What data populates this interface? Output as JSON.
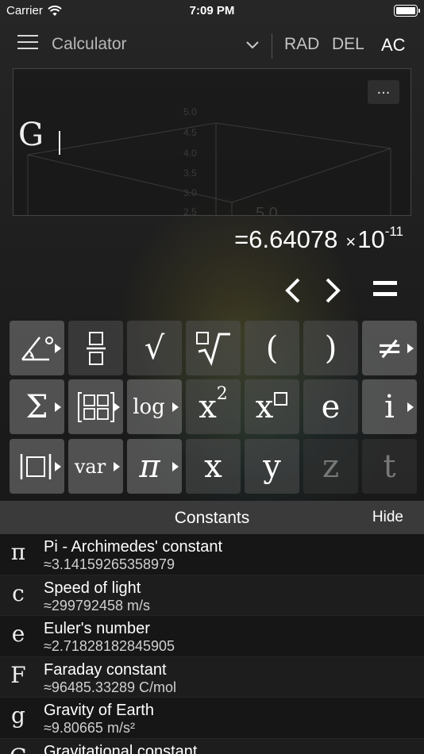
{
  "status_bar": {
    "carrier": "Carrier",
    "time": "7:09 PM"
  },
  "toolbar": {
    "title": "Calculator",
    "rad": "RAD",
    "del": "DEL",
    "ac": "AC"
  },
  "display": {
    "more": "...",
    "expression": "G",
    "plot_ticks": [
      "5.0",
      "4.5",
      "4.0",
      "3.5",
      "3.0",
      "2.5",
      "5.0"
    ]
  },
  "result": {
    "mantissa": "=6.64078",
    "times": "×",
    "base": "10",
    "exponent": "-11"
  },
  "keypad": {
    "row1": [
      "∠°",
      "fraction",
      "√",
      "ⁿ√",
      "(",
      ")",
      "≠"
    ],
    "row2": [
      "Σ",
      "matrix",
      "log",
      "x",
      "x",
      "e",
      "i"
    ],
    "row2_exp": "2",
    "row3": [
      "|□|",
      "var",
      "π",
      "x",
      "y",
      "z",
      "t"
    ]
  },
  "constants": {
    "title": "Constants",
    "hide": "Hide",
    "items": [
      {
        "symbol": "π",
        "name": "Pi - Archimedes' constant",
        "value": "≈3.14159265358979"
      },
      {
        "symbol": "c",
        "name": "Speed of light",
        "value": "≈299792458 m/s"
      },
      {
        "symbol": "e",
        "name": "Euler's number",
        "value": "≈2.71828182845905"
      },
      {
        "symbol": "F",
        "name": "Faraday constant",
        "value": "≈96485.33289 C/mol"
      },
      {
        "symbol": "g",
        "name": "Gravity of Earth",
        "value": "≈9.80665 m/s²"
      },
      {
        "symbol": "G",
        "name": "Gravitational constant",
        "value": ""
      }
    ]
  },
  "colors": {
    "background": "#1c1c1c",
    "panel_header": "#3a3a3a",
    "key": "#505050"
  }
}
